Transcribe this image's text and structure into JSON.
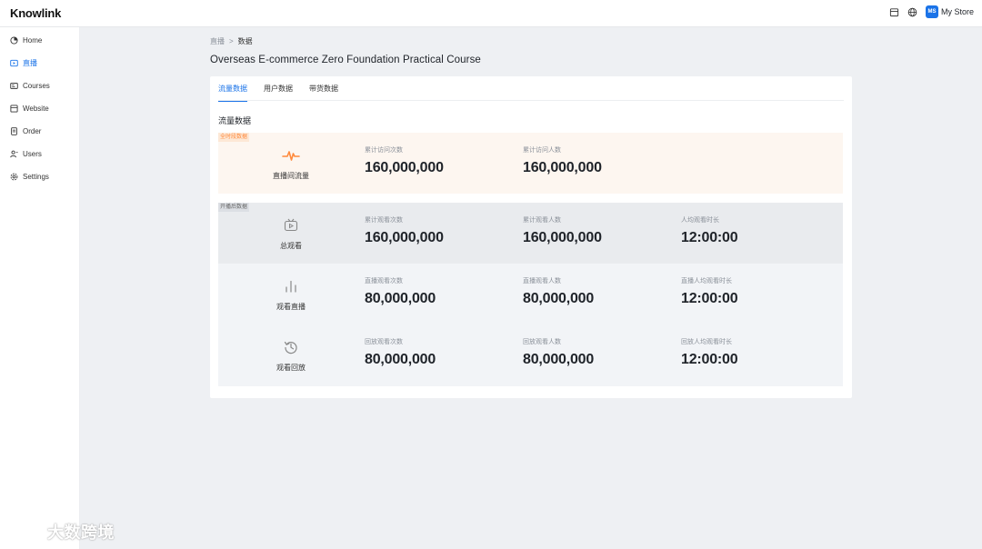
{
  "header": {
    "logo": "Knowlink",
    "store_badge": "MS",
    "store_name": "My Store"
  },
  "sidebar": {
    "items": [
      {
        "label": "Home",
        "icon": "home-icon",
        "active": false
      },
      {
        "label": "直播",
        "icon": "live-icon",
        "active": true
      },
      {
        "label": "Courses",
        "icon": "courses-icon",
        "active": false
      },
      {
        "label": "Website",
        "icon": "website-icon",
        "active": false
      },
      {
        "label": "Order",
        "icon": "order-icon",
        "active": false
      },
      {
        "label": "Users",
        "icon": "users-icon",
        "active": false
      },
      {
        "label": "Settings",
        "icon": "settings-icon",
        "active": false
      }
    ]
  },
  "breadcrumb": {
    "parent": "直播",
    "separator": ">",
    "current": "数据"
  },
  "page": {
    "title": "Overseas E-commerce Zero Foundation Practical Course"
  },
  "tabs": [
    {
      "label": "流量数据",
      "active": true
    },
    {
      "label": "用户数据",
      "active": false
    },
    {
      "label": "带货数据",
      "active": false
    }
  ],
  "section_title": "流量数据",
  "traffic_panel": {
    "tag": "全时段数据",
    "row": {
      "label": "直播间流量",
      "icon": "pulse-icon",
      "metrics": [
        {
          "label": "累计访问次数",
          "value": "160,000,000"
        },
        {
          "label": "累计访问人数",
          "value": "160,000,000"
        }
      ]
    }
  },
  "watch_panel": {
    "tag": "开播后数据",
    "total": {
      "label": "总观看",
      "icon": "tv-icon",
      "metrics": [
        {
          "label": "累计观看次数",
          "value": "160,000,000"
        },
        {
          "label": "累计观看人数",
          "value": "160,000,000"
        },
        {
          "label": "人均观看时长",
          "value": "12:00:00"
        }
      ]
    },
    "live": {
      "label": "观看直播",
      "icon": "bar-chart-icon",
      "metrics": [
        {
          "label": "直播观看次数",
          "value": "80,000,000"
        },
        {
          "label": "直播观看人数",
          "value": "80,000,000"
        },
        {
          "label": "直播人均观看时长",
          "value": "12:00:00"
        }
      ]
    },
    "replay": {
      "label": "观看回放",
      "icon": "history-icon",
      "metrics": [
        {
          "label": "回放观看次数",
          "value": "80,000,000"
        },
        {
          "label": "回放观看人数",
          "value": "80,000,000"
        },
        {
          "label": "回放人均观看时长",
          "value": "12:00:00"
        }
      ]
    }
  },
  "watermark": {
    "text": "大数跨境"
  },
  "colors": {
    "accent": "#1a73e8",
    "orange": "#ff8a3d",
    "orange_bg": "#fdf6f0",
    "gray_bg": "#e9ebee",
    "light_bg": "#f2f4f7"
  }
}
